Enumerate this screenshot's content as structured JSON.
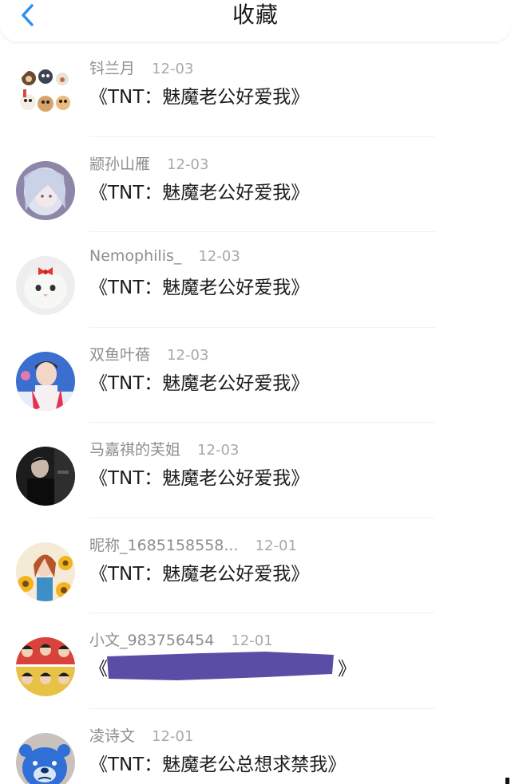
{
  "header": {
    "title": "收藏",
    "back_icon": "chevron-left-icon",
    "accent": "#2b90f0"
  },
  "favorites": [
    {
      "nickname": "钭兰月",
      "date": "12-03",
      "book": "《TNT：魅魔老公好爱我》"
    },
    {
      "nickname": "颛孙山雁",
      "date": "12-03",
      "book": "《TNT：魅魔老公好爱我》"
    },
    {
      "nickname": "Nemophilis_",
      "date": "12-03",
      "book": "《TNT：魅魔老公好爱我》"
    },
    {
      "nickname": "双鱼叶蓓",
      "date": "12-03",
      "book": "《TNT：魅魔老公好爱我》"
    },
    {
      "nickname": "马嘉祺的芙姐",
      "date": "12-03",
      "book": "《TNT：魅魔老公好爱我》"
    },
    {
      "nickname": "昵称_1685158558...",
      "date": "12-01",
      "book": "《TNT：魅魔老公好爱我》"
    },
    {
      "nickname": "小文_983756454",
      "date": "12-01",
      "book": "《",
      "book_end": "》",
      "redaction_color": "#5a4da6"
    },
    {
      "nickname": "凌诗文",
      "date": "12-01",
      "book": "《TNT：魅魔老公总想求禁我》"
    }
  ]
}
